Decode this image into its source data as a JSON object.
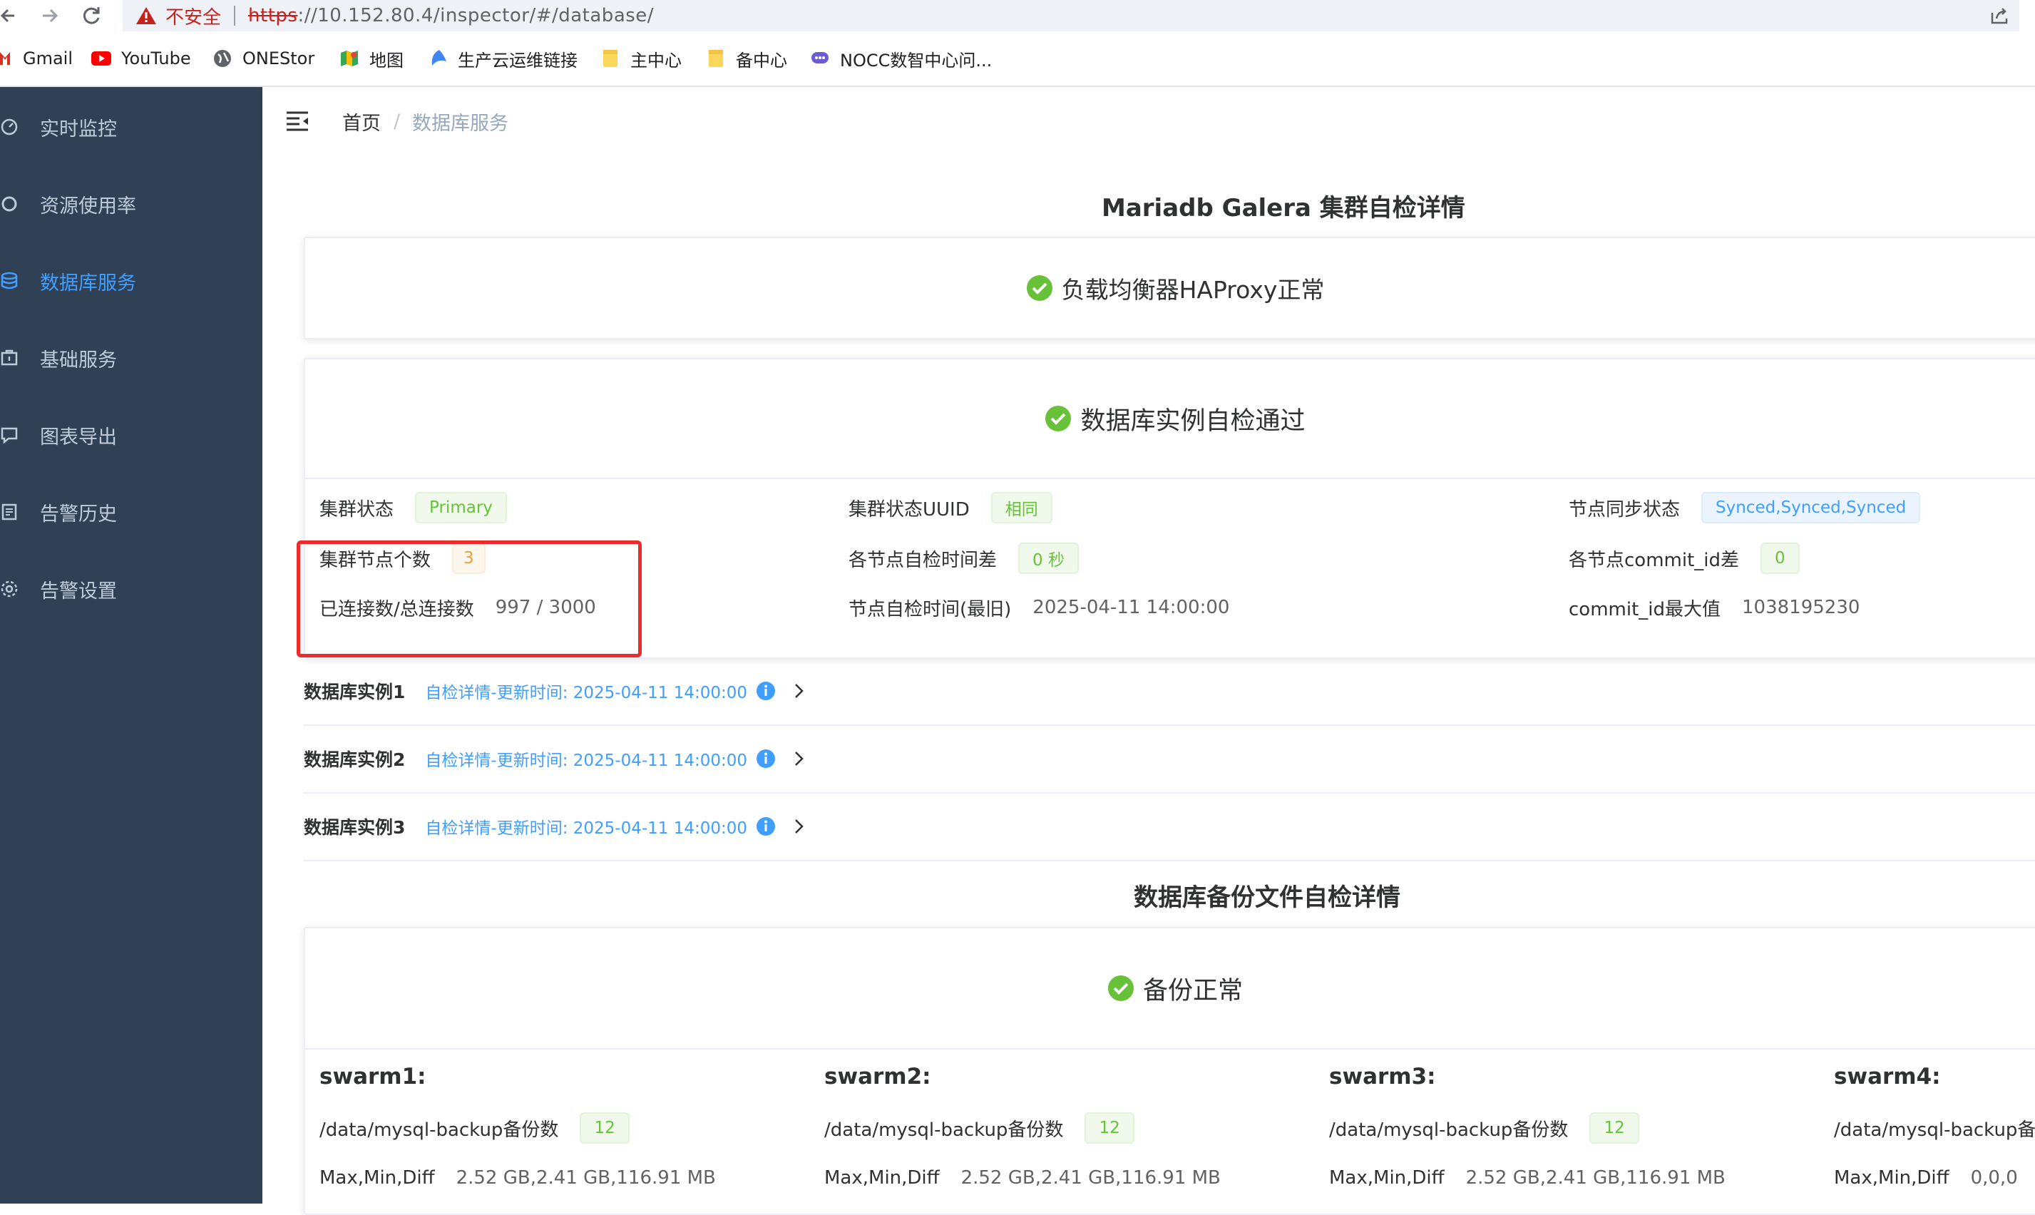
{
  "browser": {
    "security_label": "不安全",
    "url_scheme": "https",
    "url_rest": "://10.152.80.4/inspector/#/database/"
  },
  "bookmarks": [
    {
      "label": "Gmail",
      "icon": "gmail-icon"
    },
    {
      "label": "YouTube",
      "icon": "youtube-icon"
    },
    {
      "label": "ONEStor",
      "icon": "globe-icon"
    },
    {
      "label": "地图",
      "icon": "maps-icon"
    },
    {
      "label": "生产云运维链接",
      "icon": "cloud-icon"
    },
    {
      "label": "主中心",
      "icon": "folder-icon"
    },
    {
      "label": "备中心",
      "icon": "folder-icon"
    },
    {
      "label": "NOCC数智中心问...",
      "icon": "chat-icon"
    }
  ],
  "sidebar": {
    "items": [
      {
        "label": "实时监控",
        "icon": "dashboard-icon"
      },
      {
        "label": "资源使用率",
        "icon": "resource-icon"
      },
      {
        "label": "数据库服务",
        "icon": "database-icon",
        "active": true
      },
      {
        "label": "基础服务",
        "icon": "service-icon"
      },
      {
        "label": "图表导出",
        "icon": "export-icon"
      },
      {
        "label": "告警历史",
        "icon": "history-icon"
      },
      {
        "label": "告警设置",
        "icon": "settings-icon"
      }
    ]
  },
  "breadcrumb": {
    "home": "首页",
    "separator": "/",
    "current": "数据库服务"
  },
  "galera": {
    "title": "Mariadb Galera 集群自检详情",
    "haproxy_status": "负载均衡器HAProxy正常",
    "instance_status": "数据库实例自检通过",
    "fields": {
      "cluster_state_label": "集群状态",
      "cluster_state_value": "Primary",
      "cluster_uuid_label": "集群状态UUID",
      "cluster_uuid_value": "相同",
      "node_sync_label": "节点同步状态",
      "node_sync_value": "Synced,Synced,Synced",
      "node_count_label": "集群节点个数",
      "node_count_value": "3",
      "time_diff_label": "各节点自检时间差",
      "time_diff_value": "0 秒",
      "commit_diff_label": "各节点commit_id差",
      "commit_diff_value": "0",
      "connections_label": "已连接数/总连接数",
      "connections_value": "997 / 3000",
      "latest_check_label": "节点自检时间(最旧)",
      "latest_check_value": "2025-04-11 14:00:00",
      "commit_max_label": "commit_id最大值",
      "commit_max_value": "1038195230"
    },
    "instances": [
      {
        "title": "数据库实例1",
        "link": "自检详情-更新时间: 2025-04-11 14:00:00"
      },
      {
        "title": "数据库实例2",
        "link": "自检详情-更新时间: 2025-04-11 14:00:00"
      },
      {
        "title": "数据库实例3",
        "link": "自检详情-更新时间: 2025-04-11 14:00:00"
      }
    ]
  },
  "backup": {
    "title": "数据库备份文件自检详情",
    "status": "备份正常",
    "swarms": [
      {
        "name": "swarm1:",
        "count_label": "/data/mysql-backup备份数",
        "count_value": "12",
        "size_label": "Max,Min,Diff",
        "size_value": "2.52 GB,2.41 GB,116.91 MB"
      },
      {
        "name": "swarm2:",
        "count_label": "/data/mysql-backup备份数",
        "count_value": "12",
        "size_label": "Max,Min,Diff",
        "size_value": "2.52 GB,2.41 GB,116.91 MB"
      },
      {
        "name": "swarm3:",
        "count_label": "/data/mysql-backup备份数",
        "count_value": "12",
        "size_label": "Max,Min,Diff",
        "size_value": "2.52 GB,2.41 GB,116.91 MB"
      },
      {
        "name": "swarm4:",
        "count_label": "/data/mysql-backup备份数",
        "count_value": "",
        "size_label": "Max,Min,Diff",
        "size_value": "0,0,0"
      }
    ]
  },
  "colors": {
    "sidebar_bg": "#304156",
    "active": "#409eff",
    "success": "#67c23a",
    "highlight": "#ee2b2b"
  }
}
